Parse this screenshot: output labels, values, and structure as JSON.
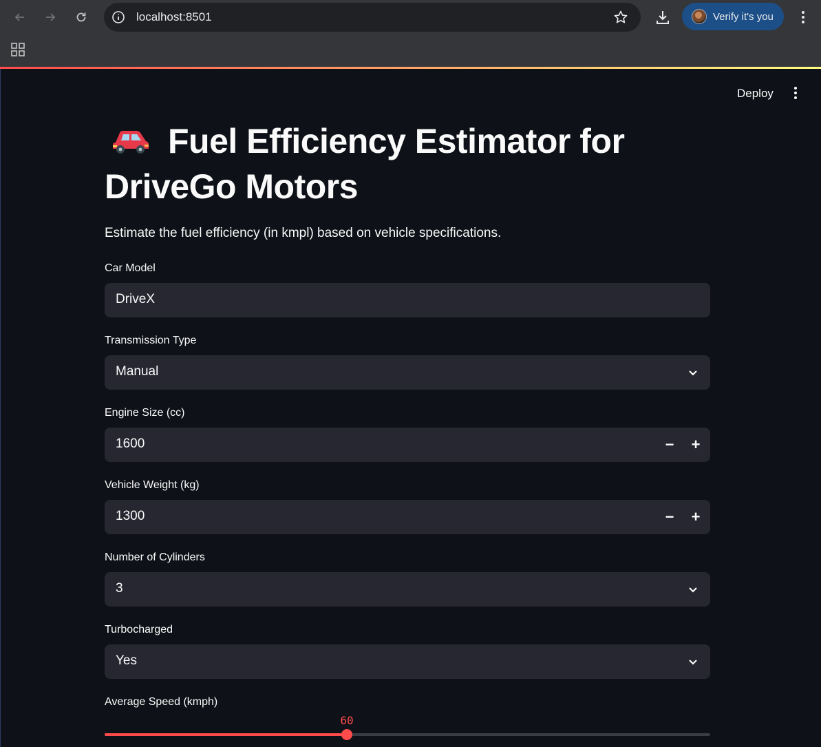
{
  "browser": {
    "url": "localhost:8501",
    "verify_label": "Verify it's you"
  },
  "app_header": {
    "deploy_label": "Deploy"
  },
  "main": {
    "title": "Fuel Efficiency Estimator for DriveGo Motors",
    "subtitle": "Estimate the fuel efficiency (in kmpl) based on vehicle specifications."
  },
  "fields": {
    "car_model": {
      "label": "Car Model",
      "value": "DriveX"
    },
    "transmission": {
      "label": "Transmission Type",
      "value": "Manual"
    },
    "engine_size": {
      "label": "Engine Size (cc)",
      "value": "1600"
    },
    "vehicle_weight": {
      "label": "Vehicle Weight (kg)",
      "value": "1300"
    },
    "cylinders": {
      "label": "Number of Cylinders",
      "value": "3"
    },
    "turbocharged": {
      "label": "Turbocharged",
      "value": "Yes"
    },
    "avg_speed": {
      "label": "Average Speed (kmph)",
      "value": "60",
      "fraction": 0.4
    }
  },
  "colors": {
    "accent": "#ff4b4b",
    "background": "#0e1117",
    "input_bg": "#262730",
    "chrome_bg": "#35363a",
    "verify_bg": "#1c4f87"
  },
  "icons": [
    "back-arrow-icon",
    "forward-arrow-icon",
    "reload-icon",
    "site-info-icon",
    "bookmark-star-icon",
    "download-icon",
    "browser-menu-icon",
    "apps-grid-icon",
    "app-menu-icon",
    "car-emoji-icon",
    "chevron-down-icon"
  ]
}
